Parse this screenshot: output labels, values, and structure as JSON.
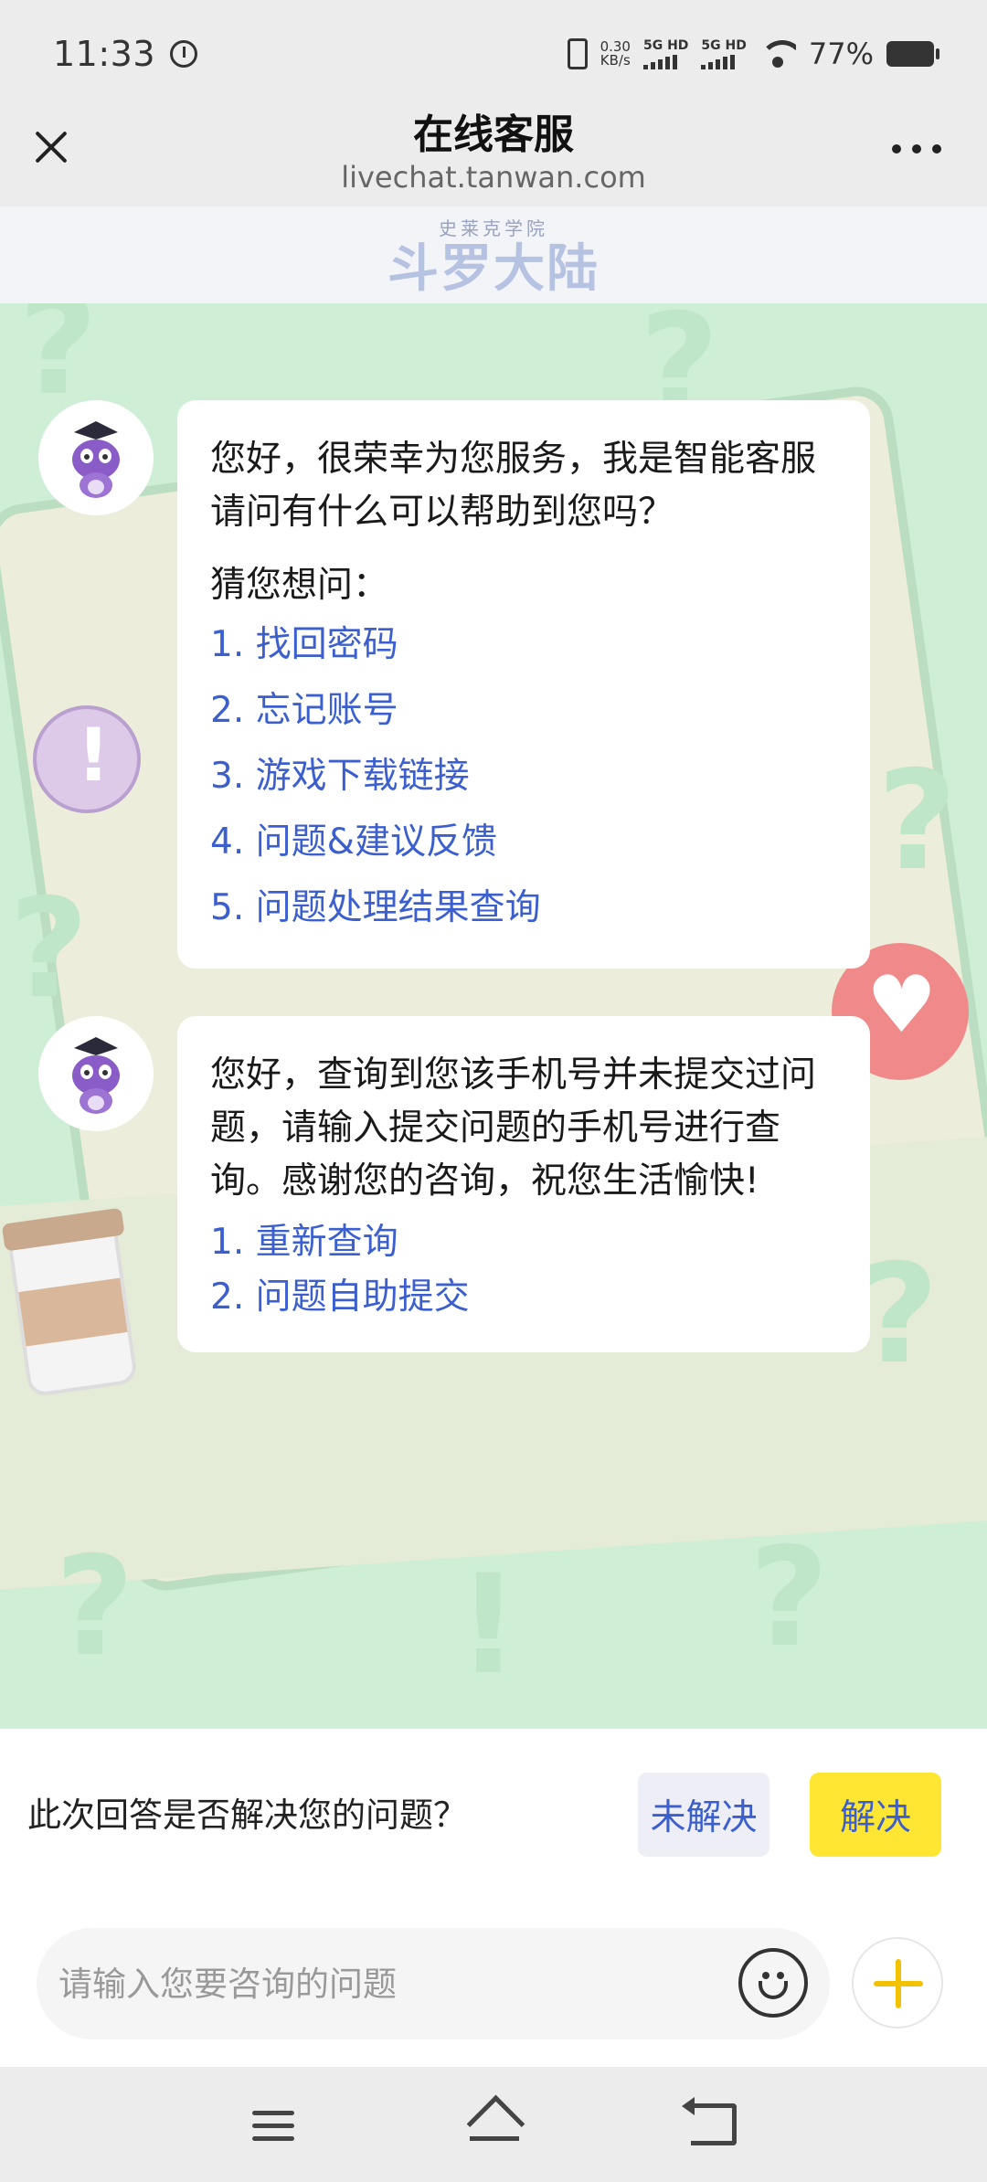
{
  "status_bar": {
    "time": "11:33",
    "speed_value": "0.30",
    "speed_unit": "KB/s",
    "network1": "5G HD",
    "network2": "5G HD",
    "battery": "77%"
  },
  "header": {
    "title": "在线客服",
    "url": "livechat.tanwan.com"
  },
  "logo": {
    "small_text": "史莱克学院",
    "big_text": "斗罗大陆"
  },
  "messages": [
    {
      "text": "您好，很荣幸为您服务，我是智能客服请问有什么可以帮助到您吗？",
      "guess_label": "猜您想问：",
      "options": [
        "1. 找回密码",
        "2. 忘记账号",
        "3. 游戏下载链接",
        "4. 问题&建议反馈",
        "5. 问题处理结果查询"
      ]
    },
    {
      "text": "您好，查询到您该手机号并未提交过问题，请输入提交问题的手机号进行查询。感谢您的咨询，祝您生活愉快!",
      "options": [
        "1. 重新查询",
        "2. 问题自助提交"
      ]
    }
  ],
  "feedback": {
    "question": "此次回答是否解决您的问题？",
    "unsolved_label": "未解决",
    "solved_label": "解决"
  },
  "input": {
    "placeholder": "请输入您要咨询的问题"
  },
  "colors": {
    "chat_bg": "#cfeed6",
    "link": "#3c5fd0",
    "solved_bg": "#ffe632",
    "plus_accent": "#f2c200"
  }
}
